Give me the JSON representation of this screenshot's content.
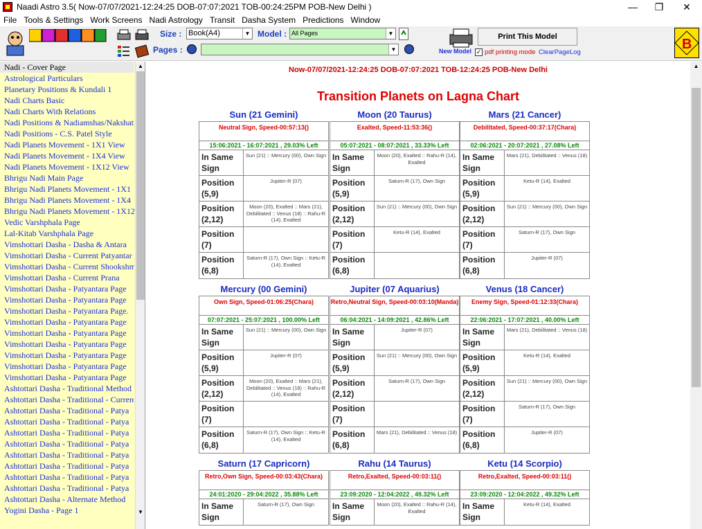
{
  "window": {
    "title": "Naadi Astro 3.5( Now-07/07/2021-12:24:25 DOB-07:07:2021 TOB-00:24:25PM POB-New Delhi )",
    "minimize": "—",
    "restore": "❐",
    "close": "✕"
  },
  "menu": [
    "File",
    "Tools & Settings",
    "Work Screens",
    "Nadi Astrology",
    "Transit",
    "Dasha System",
    "Predictions",
    "Window"
  ],
  "toolbar": {
    "size_label": "Size :",
    "size_value": "Book(A4)",
    "model_label": "Model :",
    "model_value": "All Pages",
    "pages_label": "Pages :",
    "pages_value": "",
    "print_model": "Print This Model",
    "new_model": "New Model",
    "pdf_mode": "pdf printing mode",
    "clear_log": "ClearPageLog"
  },
  "sidebar": {
    "items": [
      "Nadi - Cover Page",
      "Astrological Particulars",
      "Planetary Positions & Kundali 1",
      "Nadi Charts Basic",
      "Nadi Charts With Relations",
      "Nadi Positions & Nadiamshas/Nakshatras",
      "Nadi Positions - C.S. Patel Style",
      "Nadi Planets Movement - 1X1 View",
      "Nadi Planets Movement - 1X4 View",
      "Nadi Planets Movement - 1X12 View",
      "Bhrigu Nadi Main Page",
      "Bhrigu Nadi Planets Movement - 1X1",
      "Bhrigu Nadi Planets Movement - 1X4",
      "Bhrigu Nadi Planets Movement - 1X12",
      "Vedic Varshphala Page",
      "Lal-Kitab Varshphala Page",
      "Vimshottari Dasha - Dasha & Antara",
      "Vimshottari Dasha - Current Patyantar",
      "Vimshottari Dasha - Current Shookshma",
      "Vimshottari Dasha - Current Prana",
      "Vimshottari Dasha - Patyantara Page",
      "Vimshottari Dasha - Patyantara Page",
      "Vimshottari Dasha - Patyantara Page.",
      "Vimshottari Dasha - Patyantara Page",
      "Vimshottari Dasha - Patyantara Page",
      "Vimshottari Dasha - Patyantara Page",
      "Vimshottari Dasha - Patyantara Page",
      "Vimshottari Dasha - Patyantara Page",
      "Vimshottari Dasha - Patyantara Page",
      "Ashtottari Dasha - Traditional Method",
      "Ashtottari Dasha - Traditional - Current",
      "Ashtottari Dasha - Traditional - Patya",
      "Ashtottari Dasha - Traditional - Patya",
      "Ashtottari Dasha - Traditional - Patya",
      "Ashtottari Dasha - Traditional - Patya",
      "Ashtottari Dasha - Traditional - Patya",
      "Ashtottari Dasha - Traditional - Patya",
      "Ashtottari Dasha - Traditional - Patya",
      "Ashtottari Dasha - Traditional - Patya",
      "Ashtottari Dasha - Alternate Method",
      "Yogini Dasha - Page 1"
    ]
  },
  "page": {
    "header": "Now-07/07/2021-12:24:25 DOB-07:07:2021 TOB-12:24:25 POB-New Delhi",
    "title": "Transition Planets on Lagna Chart"
  },
  "labels": {
    "same": "In Same Sign",
    "p59": "Position (5,9)",
    "p212": "Position (2,12)",
    "p7": "Position (7)",
    "p68": "Position (6,8)"
  },
  "planets": [
    {
      "name": "Sun (21 Gemini)",
      "status": "Neutral Sign, Speed-00:57:13()",
      "dates": "15:06:2021 - 16:07:2021 , 29.03% Left",
      "rows": [
        "Sun (21) :: Mercury (00), Own Sign",
        "Jupiter-R (07)",
        "Moon (20), Exalted :: Mars (21), Debilitated :: Venus (18) :: Rahu-R (14), Exalted",
        "",
        "Saturn-R (17), Own Sign :: Ketu-R (14), Exalted"
      ]
    },
    {
      "name": "Moon (20 Taurus)",
      "status": "Exalted, Speed-11:53:36()",
      "dates": "05:07:2021 - 08:07:2021 , 33.33% Left",
      "rows": [
        "Moon (20), Exalted :: Rahu-R (14), Exalted",
        "Saturn-R (17), Own Sign",
        "Sun (21) :: Mercury (00), Own Sign",
        "Ketu-R (14), Exalted",
        ""
      ]
    },
    {
      "name": "Mars (21 Cancer)",
      "status": "Debilitated, Speed-00:37:17(Chara)",
      "dates": "02:06:2021 - 20:07:2021 , 27.08% Left",
      "rows": [
        "Mars (21), Debilitated :: Venus (18)",
        "Ketu-R (14), Exalted",
        "Sun (21) :: Mercury (00), Own Sign",
        "Saturn-R (17), Own Sign",
        "Jupiter-R (07)"
      ]
    },
    {
      "name": "Mercury (00 Gemini)",
      "status": "Own Sign, Speed-01:06:25(Chara)",
      "dates": "07:07:2021 - 25:07:2021 , 100.00% Left",
      "rows": [
        "Sun (21) :: Mercury (00), Own Sign",
        "Jupiter-R (07)",
        "Moon (20), Exalted :: Mars (21), Debilitated :: Venus (18) :: Rahu-R (14), Exalted",
        "",
        "Saturn-R (17), Own Sign :: Ketu-R (14), Exalted"
      ]
    },
    {
      "name": "Jupiter (07 Aquarius)",
      "status": "Retro,Neutral Sign, Speed-00:03:10(Manda)",
      "dates": "06:04:2021 - 14:09:2021 , 42.86% Left",
      "rows": [
        "Jupiter-R (07)",
        "Sun (21) :: Mercury (00), Own Sign",
        "Saturn-R (17), Own Sign",
        "",
        "Mars (21), Debilitated :: Venus (18)"
      ]
    },
    {
      "name": "Venus (18 Cancer)",
      "status": "Enemy Sign, Speed-01:12:33(Chara)",
      "dates": "22:06:2021 - 17:07:2021 , 40.00% Left",
      "rows": [
        "Mars (21), Debilitated :: Venus (18)",
        "Ketu-R (14), Exalted",
        "Sun (21) :: Mercury (00), Own Sign",
        "Saturn-R (17), Own Sign",
        "Jupiter-R (07)"
      ]
    },
    {
      "name": "Saturn (17 Capricorn)",
      "status": "Retro,Own Sign, Speed-00:03:43(Chara)",
      "dates": "24:01:2020 - 29:04:2022 , 35.88% Left",
      "rows": [
        "Saturn-R (17), Own Sign"
      ]
    },
    {
      "name": "Rahu (14 Taurus)",
      "status": "Retro,Exalted, Speed-00:03:11()",
      "dates": "23:09:2020 - 12:04:2022 , 49.32% Left",
      "rows": [
        "Moon (20), Exalted :: Rahu-R (14), Exalted"
      ]
    },
    {
      "name": "Ketu (14 Scorpio)",
      "status": "Retro,Exalted, Speed-00:03:11()",
      "dates": "23:09:2020 - 12:04:2022 , 49.32% Left",
      "rows": [
        "Ketu-R (14), Exalted"
      ]
    }
  ]
}
